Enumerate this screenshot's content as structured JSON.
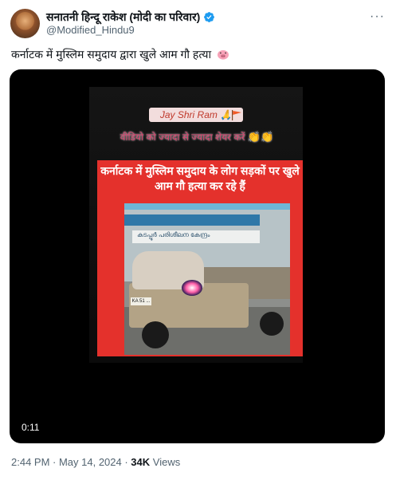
{
  "author": {
    "display_name": "सनातनी हिन्दू राकेश (मोदी का परिवार)",
    "handle": "@Modified_Hindu9",
    "verified_icon": "verified-badge-icon",
    "avatar_icon": "profile-avatar"
  },
  "more_label": "···",
  "tweet": {
    "text": "कर्नाटक में मुस्लिम समुदाय द्वारा खुले आम गौ हत्या",
    "emoji_icon": "pig-face-icon"
  },
  "video": {
    "overlay_top": "Jay Shri Ram 🙏",
    "overlay_pink": "वीडियो को ज्यादा से ज्यादा शेयर करें",
    "overlay_clap": "👏👏",
    "caption": "कर्नाटक में मुस्लिम समुदाय के लोग सड़कों पर खुले आम गौ हत्या कर रहे हैं",
    "plate": "KA 51 ...",
    "sign": "കടപ്പൂർ പരിശീലന കേന്ദ്രം",
    "duration": "0:11"
  },
  "meta": {
    "time": "2:44 PM · May 14, 2024 · ",
    "views_count": "34K",
    "views_label": " Views"
  },
  "colors": {
    "accent_blue": "#1d9bf0",
    "caption_red": "#e4312c",
    "muted_text": "#536471"
  }
}
